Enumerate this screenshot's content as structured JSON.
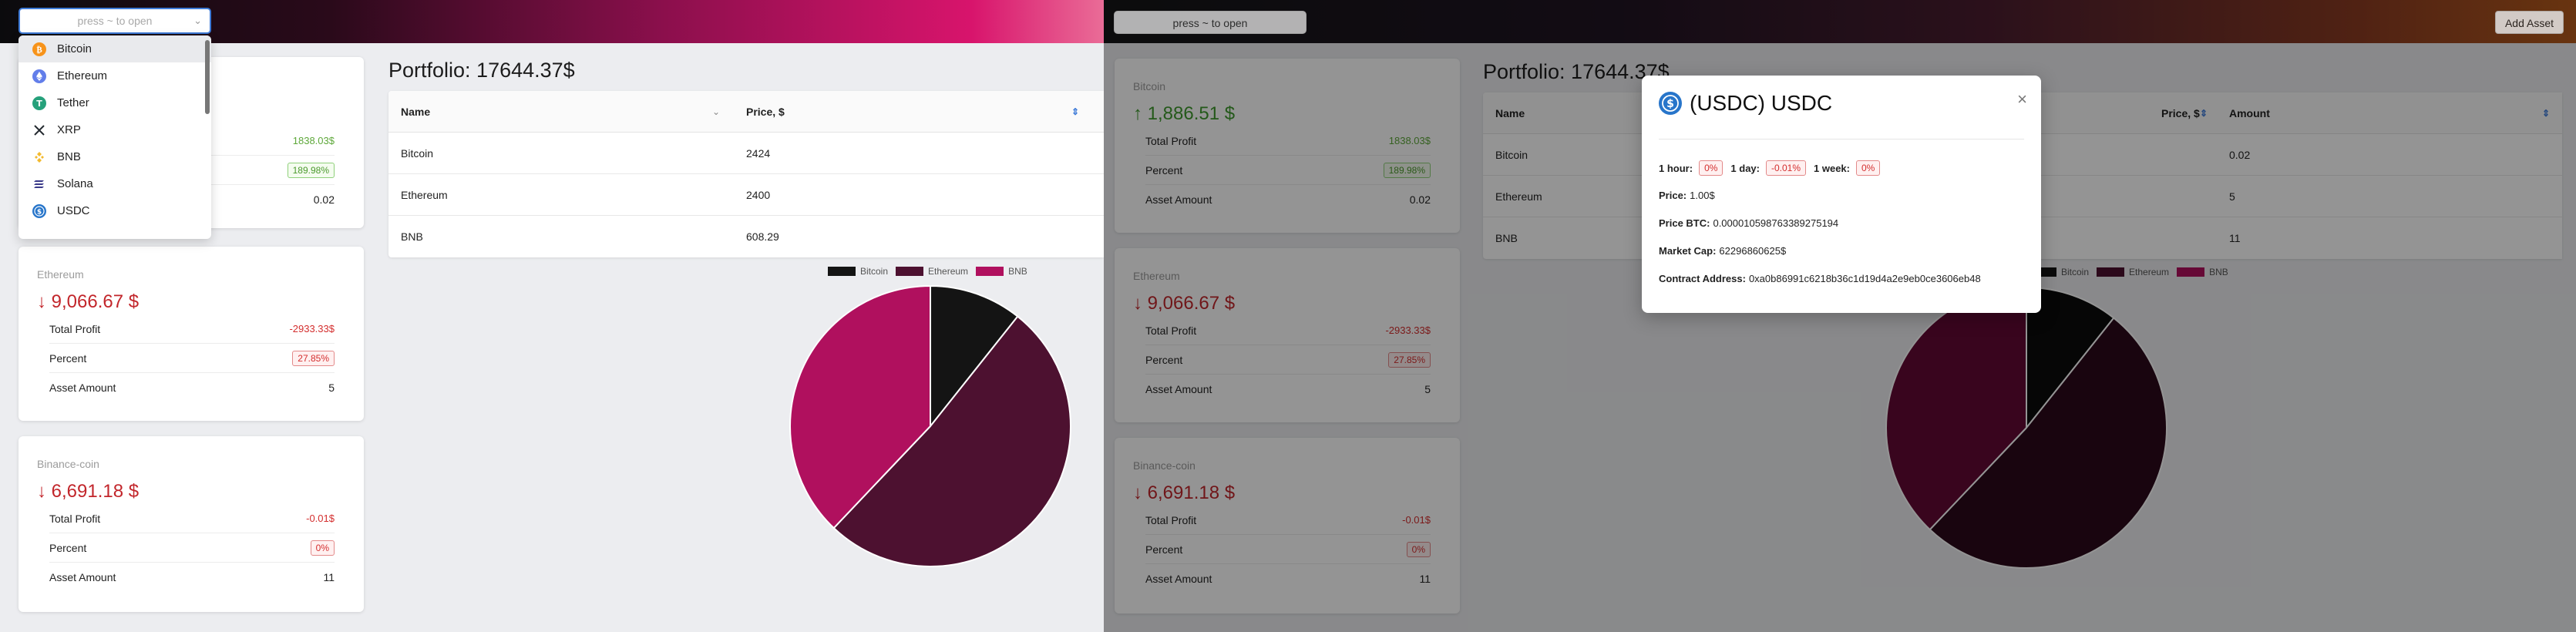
{
  "select": {
    "placeholder": "press ~ to open"
  },
  "dropdown_items": [
    {
      "label": "Bitcoin",
      "icon": "bitcoin-icon",
      "color": "#f7931a"
    },
    {
      "label": "Ethereum",
      "icon": "ethereum-icon",
      "color": "#627eea"
    },
    {
      "label": "Tether",
      "icon": "tether-icon",
      "color": "#26a17b"
    },
    {
      "label": "XRP",
      "icon": "xrp-icon",
      "color": "#23292f"
    },
    {
      "label": "BNB",
      "icon": "bnb-icon",
      "color": "#f3ba2f"
    },
    {
      "label": "Solana",
      "icon": "solana-icon",
      "color": "#3a3a8a"
    },
    {
      "label": "USDC",
      "icon": "usdc-icon",
      "color": "#2775ca"
    }
  ],
  "portfolio": {
    "title": "Portfolio: 17644.37$"
  },
  "cards": [
    {
      "name": "Bitcoin",
      "value": "↑ 1,886.51 $",
      "trend": "up",
      "rows": [
        {
          "label": "Total Profit",
          "value": "1838.03$"
        },
        {
          "label": "Percent",
          "value": "189.98%"
        },
        {
          "label": "Asset Amount",
          "value": "0.02"
        }
      ]
    },
    {
      "name": "Ethereum",
      "value": "↓ 9,066.67 $",
      "trend": "down",
      "rows": [
        {
          "label": "Total Profit",
          "value": "-2933.33$"
        },
        {
          "label": "Percent",
          "value": "27.85%"
        },
        {
          "label": "Asset Amount",
          "value": "5"
        }
      ]
    },
    {
      "name": "Binance-coin",
      "value": "↓ 6,691.18 $",
      "trend": "down",
      "rows": [
        {
          "label": "Total Profit",
          "value": "-0.01$"
        },
        {
          "label": "Percent",
          "value": "0%"
        },
        {
          "label": "Asset Amount",
          "value": "11"
        }
      ]
    }
  ],
  "table": {
    "headers": {
      "name": "Name",
      "price": "Price, $",
      "amount": "Amount"
    },
    "rows": [
      {
        "name": "Bitcoin",
        "price": "2424",
        "amount": "0.02"
      },
      {
        "name": "Ethereum",
        "price": "2400",
        "amount": "5"
      },
      {
        "name": "BNB",
        "price": "608.29",
        "amount": "11"
      }
    ]
  },
  "chart_data": {
    "type": "pie",
    "categories": [
      "Bitcoin",
      "Ethereum",
      "BNB"
    ],
    "values": [
      1886.51,
      9066.67,
      6691.18
    ],
    "colors": [
      "#141414",
      "#4d1130",
      "#b0105e"
    ],
    "colors_dimmed": [
      "#0b0b0b",
      "#2b0a1b",
      "#630a35"
    ],
    "legend_position": "top"
  },
  "modal": {
    "title": "(USDC) USDC",
    "hour_label": "1 hour:",
    "hour_value": "0%",
    "day_label": "1 day:",
    "day_value": "-0.01%",
    "week_label": "1 week:",
    "week_value": "0%",
    "price_label": "Price:",
    "price_value": "1.00$",
    "btc_label": "Price BTC:",
    "btc_value": "0.000010598763389275194",
    "cap_label": "Market Cap:",
    "cap_value": "62296860625$",
    "contract_label": "Contract Address:",
    "contract_value": "0xa0b86991c6218b36c1d19d4a2e9eb0ce3606eb48",
    "close_glyph": "×"
  },
  "right_header": {
    "open_label": "press ~ to open",
    "add_label": "Add Asset"
  }
}
